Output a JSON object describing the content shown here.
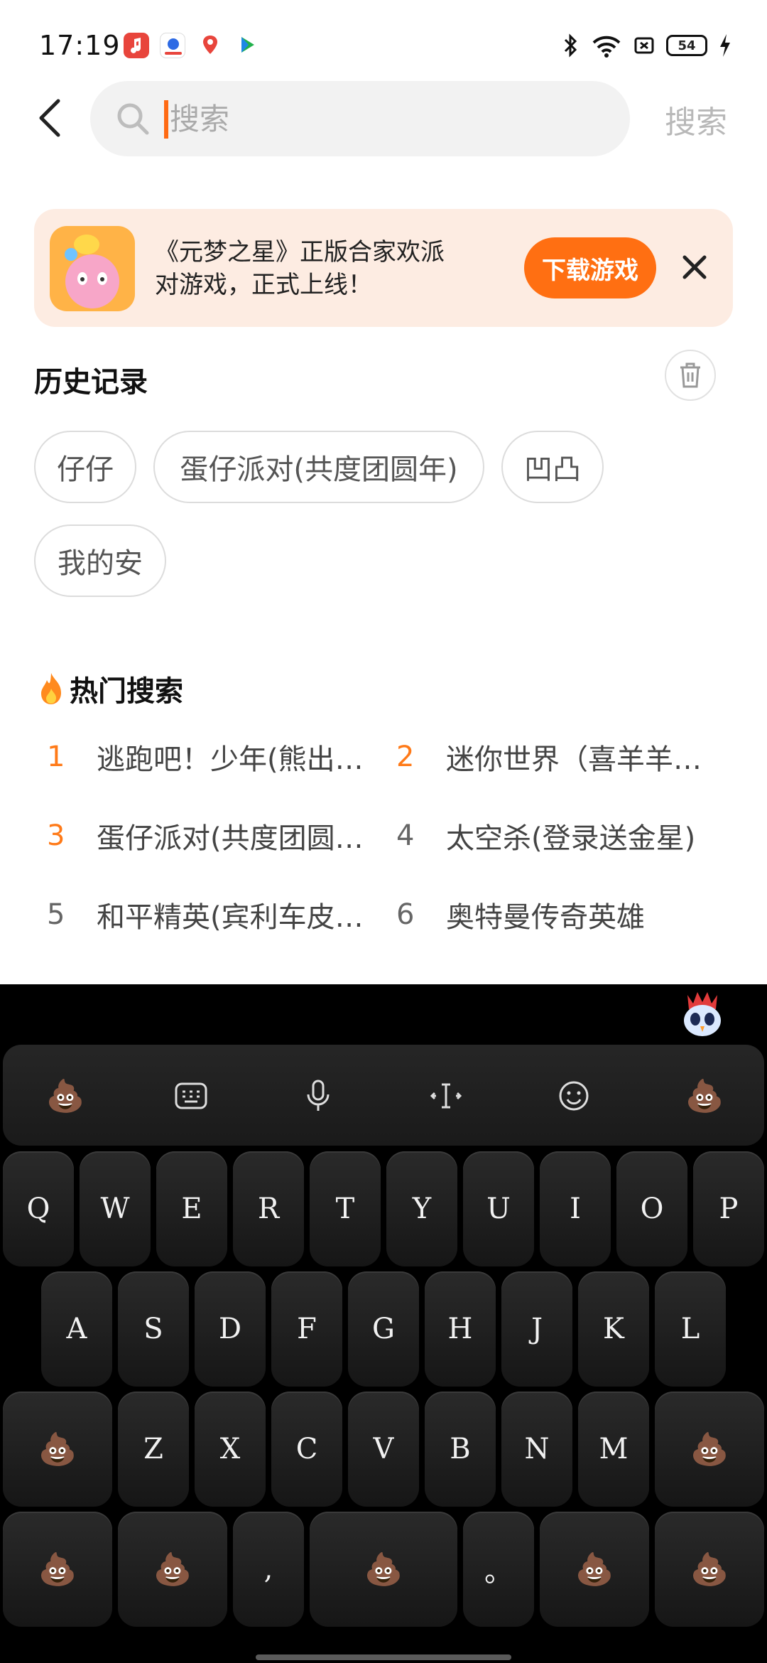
{
  "status_bar": {
    "time": "17:19",
    "battery": "54"
  },
  "search": {
    "placeholder": "搜索",
    "submit_label": "搜索"
  },
  "banner": {
    "text": "《元梦之星》正版合家欢派对游戏，正式上线！",
    "button_label": "下载游戏"
  },
  "history": {
    "title": "历史记录",
    "items": [
      "仔仔",
      "蛋仔派对(共度团圆年)",
      "凹凸",
      "我的安"
    ]
  },
  "hot_search": {
    "title": "热门搜索",
    "items": [
      {
        "rank": "1",
        "label": "逃跑吧！少年(熊出…"
      },
      {
        "rank": "2",
        "label": "迷你世界（喜羊羊…"
      },
      {
        "rank": "3",
        "label": "蛋仔派对(共度团圆…"
      },
      {
        "rank": "4",
        "label": "太空杀(登录送金星)"
      },
      {
        "rank": "5",
        "label": "和平精英(宾利车皮…"
      },
      {
        "rank": "6",
        "label": "奥特曼传奇英雄"
      }
    ]
  },
  "keyboard": {
    "row1": [
      "Q",
      "W",
      "E",
      "R",
      "T",
      "Y",
      "U",
      "I",
      "O",
      "P"
    ],
    "row2": [
      "A",
      "S",
      "D",
      "F",
      "G",
      "H",
      "J",
      "K",
      "L"
    ],
    "row3": [
      "Z",
      "X",
      "C",
      "V",
      "B",
      "N",
      "M"
    ],
    "comma": ",",
    "period": "。",
    "emoji": "💩"
  },
  "colors": {
    "accent": "#ff6f12",
    "banner_bg": "#fdece2",
    "keyboard_bg": "#000000"
  }
}
